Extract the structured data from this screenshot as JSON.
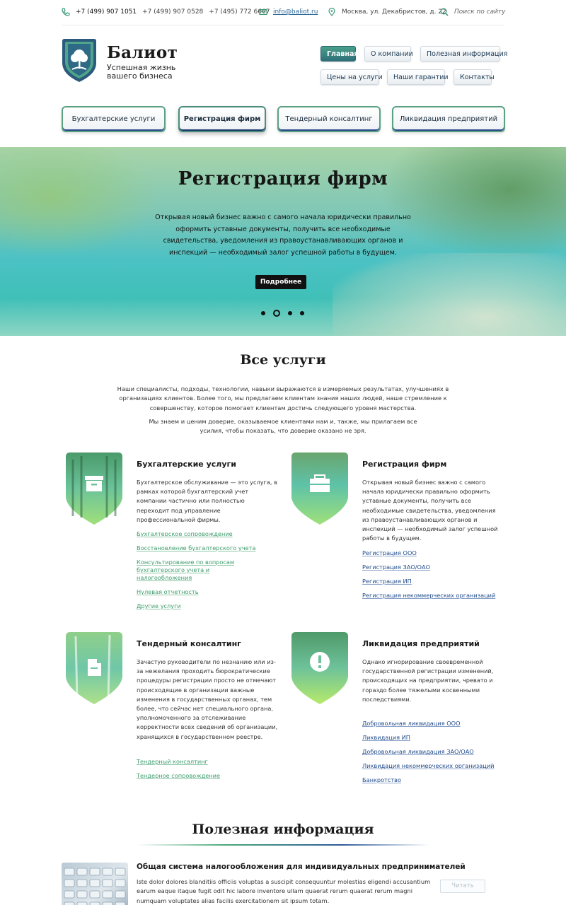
{
  "topbar": {
    "phones": [
      "+7 (499) 907 1051",
      "+7 (499) 907 0528",
      "+7 (495) 772 6667"
    ],
    "email": "info@baliot.ru",
    "address": "Москва, ул. Декабристов, д. 22",
    "search_placeholder": "Поиск по сайту"
  },
  "logo": {
    "title": "Балиот",
    "tagline_1": "Успешная жизнь",
    "tagline_2": "вашего бизнеса"
  },
  "nav": {
    "row1": [
      "Главная",
      "О компании",
      "Полезная информация"
    ],
    "row2": [
      "Цены на услуги",
      "Наши гарантии",
      "Контакты"
    ],
    "active": "Главная"
  },
  "service_tabs": [
    "Бухгалтерские услуги",
    "Регистрация фирм",
    "Тендерный консалтинг",
    "Ликвидация предприятий"
  ],
  "hero": {
    "title": "Регистрация фирм",
    "text": "Открывая новый бизнес важно с самого начала юридически правильно оформить уставные документы, получить все необходимые свидетельства, уведомления из правоустанавливающих органов и инспекций — необходимый залог успешной работы в будущем.",
    "button": "Подробнее",
    "slides_total": 4,
    "active_slide": 2
  },
  "services": {
    "title": "Все услуги",
    "intro_1": "Наши специалисты, подходы, технологии, навыки выражаются в измеряемых результатах, улучшениях в организациях клиентов. Более того, мы предлагаем клиентам знания наших людей, наше стремление к совершенству, которое помогает клиентам достичь следующего уровня мастерства.",
    "intro_2": "Мы знаем и ценим доверие, оказываемое клиентами нам и, также, мы прилагаем все усилия, чтобы показать, что доверие оказано не зря.",
    "cards": [
      {
        "title": "Бухгалтерские услуги",
        "icon": "archive-box-icon",
        "text": "Бухгалтерское обслуживание — это услуга, в рамках которой бухгалтерский учет компании частично или полностью переходит под управление профессиональной фирмы.",
        "links": [
          "Бухгалтерское сопровождение",
          "Восстановление бухгалтерского учета",
          "Консультирование по вопросам бухгалтерского учета и налогообложения",
          "Нулевая отчетность",
          "Другие услуги"
        ]
      },
      {
        "title": "Регистрация фирм",
        "icon": "briefcase-icon",
        "text": "Открывая новый бизнес важно с самого начала юридически правильно оформить уставные документы, получить все необходимые свидетельства, уведомления из правоустанавливающих органов и инспекций — необходимый залог успешной работы в будущем.",
        "links": [
          "Регистрация ООО",
          "Регистрация ЗАО/ОАО",
          "Регистрация ИП",
          "Регистрация некоммерческих организаций"
        ]
      },
      {
        "title": "Тендерный консалтинг",
        "icon": "document-icon",
        "text": "Зачастую руководители по незнанию или из-за нежелания проходить бюрократические процедуры регистрации просто не отмечают происходящие в организации важные изменения в государственных органах, тем более, что сейчас нет специального органа, уполномоченного за отслеживание корректности всех сведений об организации, хранящихся в государственном реестре.",
        "links": [
          "Тендерный консалтинг",
          "Тендерное сопровождение"
        ]
      },
      {
        "title": "Ликвидация предприятий",
        "icon": "exclamation-icon",
        "text": "Однако игнорирование своевременной государственной регистрации изменений, происходящих на предприятии, чревато и гораздо более тяжелыми косвенными последствиями.",
        "links": [
          "Добровольная ликвидация ООО",
          "Ликвидация ИП",
          "Добровольная ликвидация ЗАО/ОАО",
          "Ликвидация некоммерческих организаций",
          "Банкротство"
        ]
      }
    ]
  },
  "useful": {
    "title": "Полезная информация",
    "post_title": "Общая система налогообложения для индивидуальных предпринимателей",
    "post_text": "Iste dolor dolores blanditiis officiis voluptas a suscipit consequuntur molestias eligendi accusantium earum eaque itaque fugit odit hic labore inventore ullam quaerat rerum quaerat rerum magni numquam voluptates alias facilis exercitationem sit ipsum totam.",
    "read_button": "Читать"
  }
}
